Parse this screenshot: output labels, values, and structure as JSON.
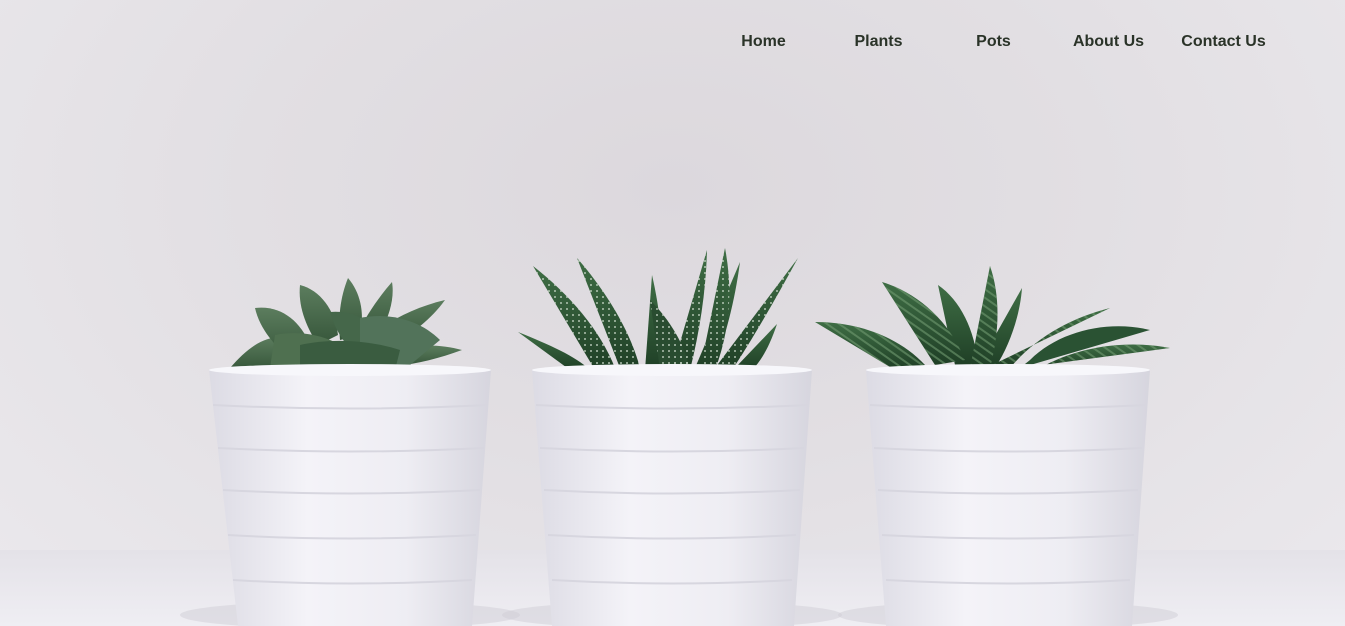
{
  "nav": {
    "items": [
      {
        "label": "Home"
      },
      {
        "label": "Plants"
      },
      {
        "label": "Pots"
      },
      {
        "label": "About Us"
      },
      {
        "label": "Contact Us"
      }
    ]
  },
  "hero": {
    "subjects": [
      "succulent-plant",
      "haworthia-plant",
      "zebra-haworthia-plant"
    ],
    "pot_color": "#f1f0f6",
    "leaf_color": "#2f5a37",
    "background_color": "#e0dde1"
  }
}
